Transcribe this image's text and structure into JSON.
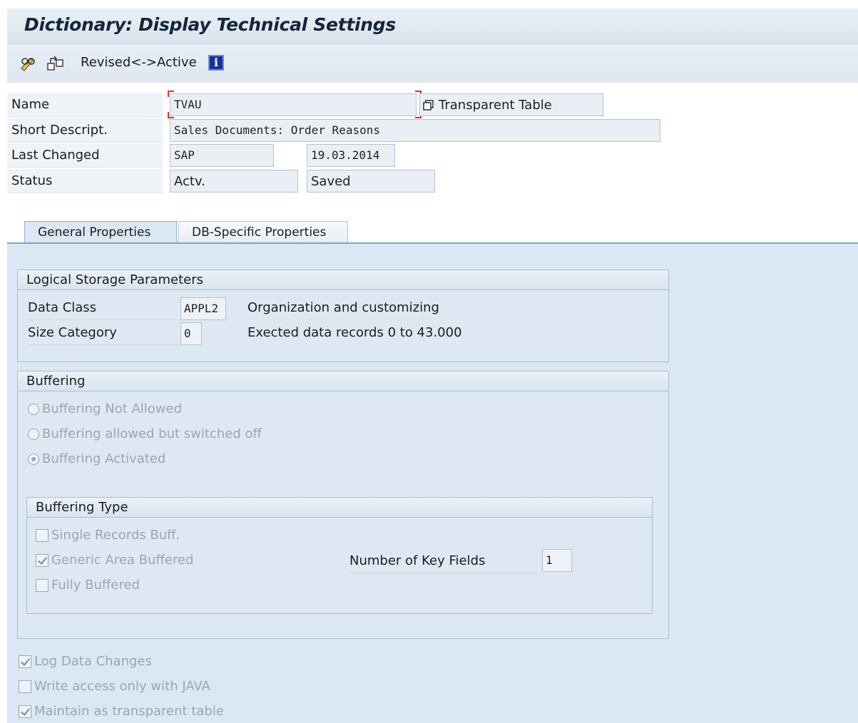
{
  "title": "Dictionary: Display Technical Settings",
  "toolbar": {
    "edit_icon": "pencil-glasses-icon",
    "other_object_icon": "other-object-icon",
    "revised_active_label": "Revised<->Active",
    "info_icon": "info-icon",
    "info_glyph": "i"
  },
  "header": {
    "name_label": "Name",
    "name_value": "TVAU",
    "name_type": "Transparent Table",
    "short_desc_label": "Short Descript.",
    "short_desc_value": "Sales Documents: Order Reasons",
    "last_changed_label": "Last Changed",
    "last_changed_user": "SAP",
    "last_changed_date": "19.03.2014",
    "status_label": "Status",
    "status_value": "Actv.",
    "status_saved": "Saved"
  },
  "tabs": [
    {
      "label": "General Properties",
      "active": true
    },
    {
      "label": "DB-Specific Properties",
      "active": false
    }
  ],
  "logical_storage": {
    "title": "Logical Storage Parameters",
    "data_class_label": "Data Class",
    "data_class_value": "APPL2",
    "data_class_desc": "Organization and customizing",
    "size_category_label": "Size Category",
    "size_category_value": "0",
    "size_category_desc": "Exected data records 0 to 43.000"
  },
  "buffering": {
    "title": "Buffering",
    "options": [
      {
        "label": "Buffering Not Allowed",
        "selected": false
      },
      {
        "label": "Buffering allowed but switched off",
        "selected": false
      },
      {
        "label": "Buffering Activated",
        "selected": true
      }
    ]
  },
  "buffering_type": {
    "title": "Buffering Type",
    "options": [
      {
        "label": "Single Records Buff.",
        "checked": false
      },
      {
        "label": "Generic Area Buffered",
        "checked": true
      },
      {
        "label": "Fully Buffered",
        "checked": false
      }
    ],
    "key_fields_label": "Number of Key Fields",
    "key_fields_value": "1"
  },
  "footer_options": [
    {
      "label": "Log Data Changes",
      "checked": true
    },
    {
      "label": "Write access only with JAVA",
      "checked": false
    },
    {
      "label": "Maintain as transparent table",
      "checked": true
    }
  ],
  "colors": {
    "title_text": "#15263a",
    "panel_bg": "#dbe7f2",
    "disabled_text": "#9aa7b3",
    "focus_marker": "#d9342b"
  }
}
